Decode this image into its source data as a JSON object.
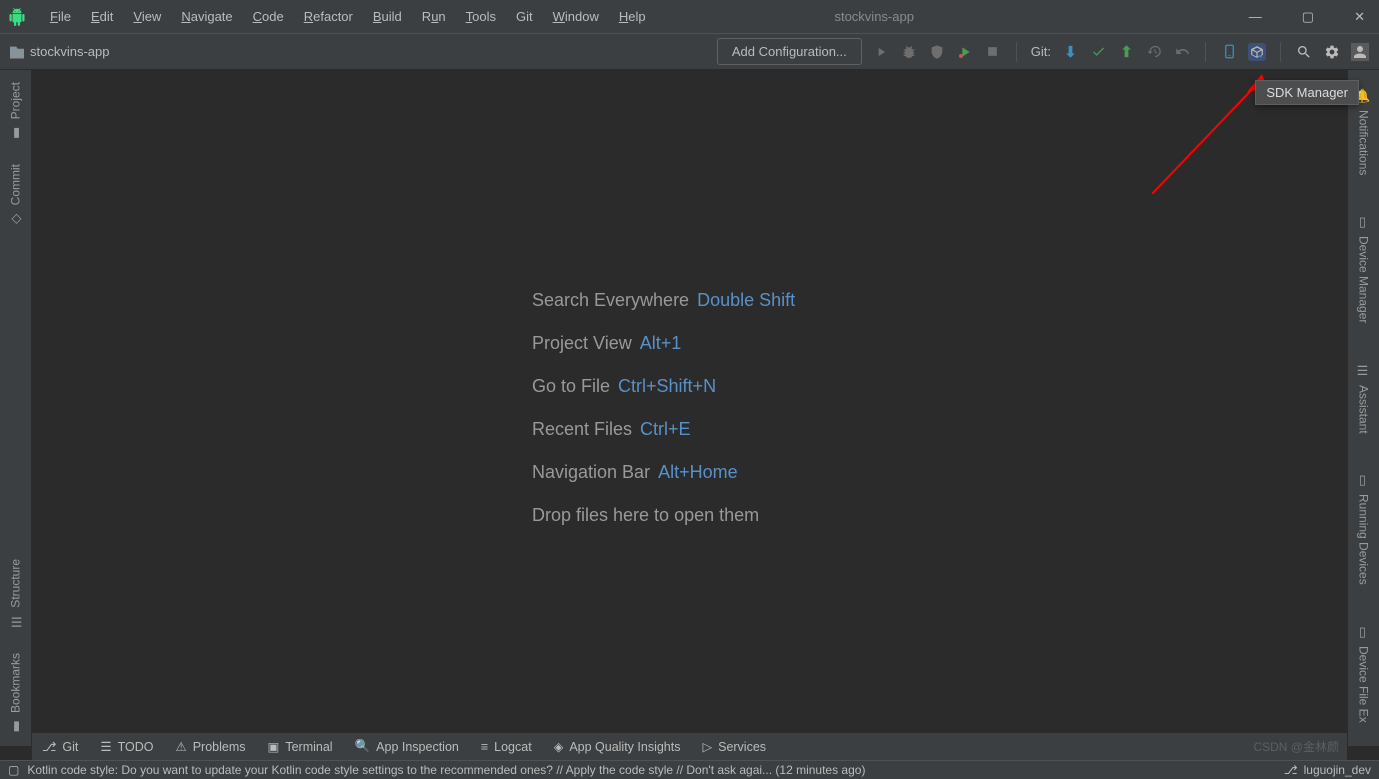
{
  "title": "stockvins-app",
  "menu": [
    "File",
    "Edit",
    "View",
    "Navigate",
    "Code",
    "Refactor",
    "Build",
    "Run",
    "Tools",
    "Git",
    "Window",
    "Help"
  ],
  "breadcrumb": "stockvins-app",
  "run_config": "Add Configuration...",
  "git_label": "Git:",
  "tooltip": "SDK Manager",
  "empty_editor": {
    "rows": [
      {
        "label": "Search Everywhere",
        "shortcut": "Double Shift"
      },
      {
        "label": "Project View",
        "shortcut": "Alt+1"
      },
      {
        "label": "Go to File",
        "shortcut": "Ctrl+Shift+N"
      },
      {
        "label": "Recent Files",
        "shortcut": "Ctrl+E"
      },
      {
        "label": "Navigation Bar",
        "shortcut": "Alt+Home"
      }
    ],
    "drop_hint": "Drop files here to open them"
  },
  "left_sidebar": {
    "top": [
      "Project",
      "Commit"
    ],
    "bottom": [
      "Structure",
      "Bookmarks"
    ]
  },
  "right_sidebar": [
    "Notifications",
    "Device Manager",
    "Assistant",
    "Running Devices",
    "Device File Ex"
  ],
  "bottom_tabs": [
    "Git",
    "TODO",
    "Problems",
    "Terminal",
    "App Inspection",
    "Logcat",
    "App Quality Insights",
    "Services"
  ],
  "status_text": "Kotlin code style: Do you want to update your Kotlin code style settings to the recommended ones? // Apply the code style // Don't ask agai... (12 minutes ago)",
  "status_right": "luguojin_dev",
  "watermark": "CSDN @金林颜"
}
